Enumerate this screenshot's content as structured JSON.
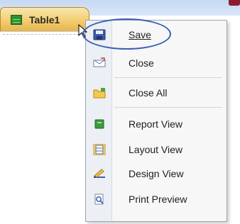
{
  "tab": {
    "label": "Table1",
    "icon": "table-icon"
  },
  "menu": {
    "items": [
      {
        "label": "Save",
        "mnemonic": "S",
        "icon": "save-icon"
      },
      {
        "label": "Close",
        "mnemonic": "C",
        "icon": "close-doc-icon"
      },
      {
        "label": "Close All",
        "mnemonic": "C",
        "icon": "folder-icon"
      },
      {
        "label": "Report View",
        "mnemonic": "R",
        "icon": "report-icon"
      },
      {
        "label": "Layout View",
        "mnemonic": "",
        "icon": "layout-icon"
      },
      {
        "label": "Design View",
        "mnemonic": "D",
        "icon": "design-icon"
      },
      {
        "label": "Print Preview",
        "mnemonic": "v",
        "icon": "print-preview-icon"
      }
    ]
  },
  "colors": {
    "tab_gold": "#f3cd6e",
    "highlight_ring": "#3a5fb3",
    "menu_bg": "#f7f7f7"
  }
}
